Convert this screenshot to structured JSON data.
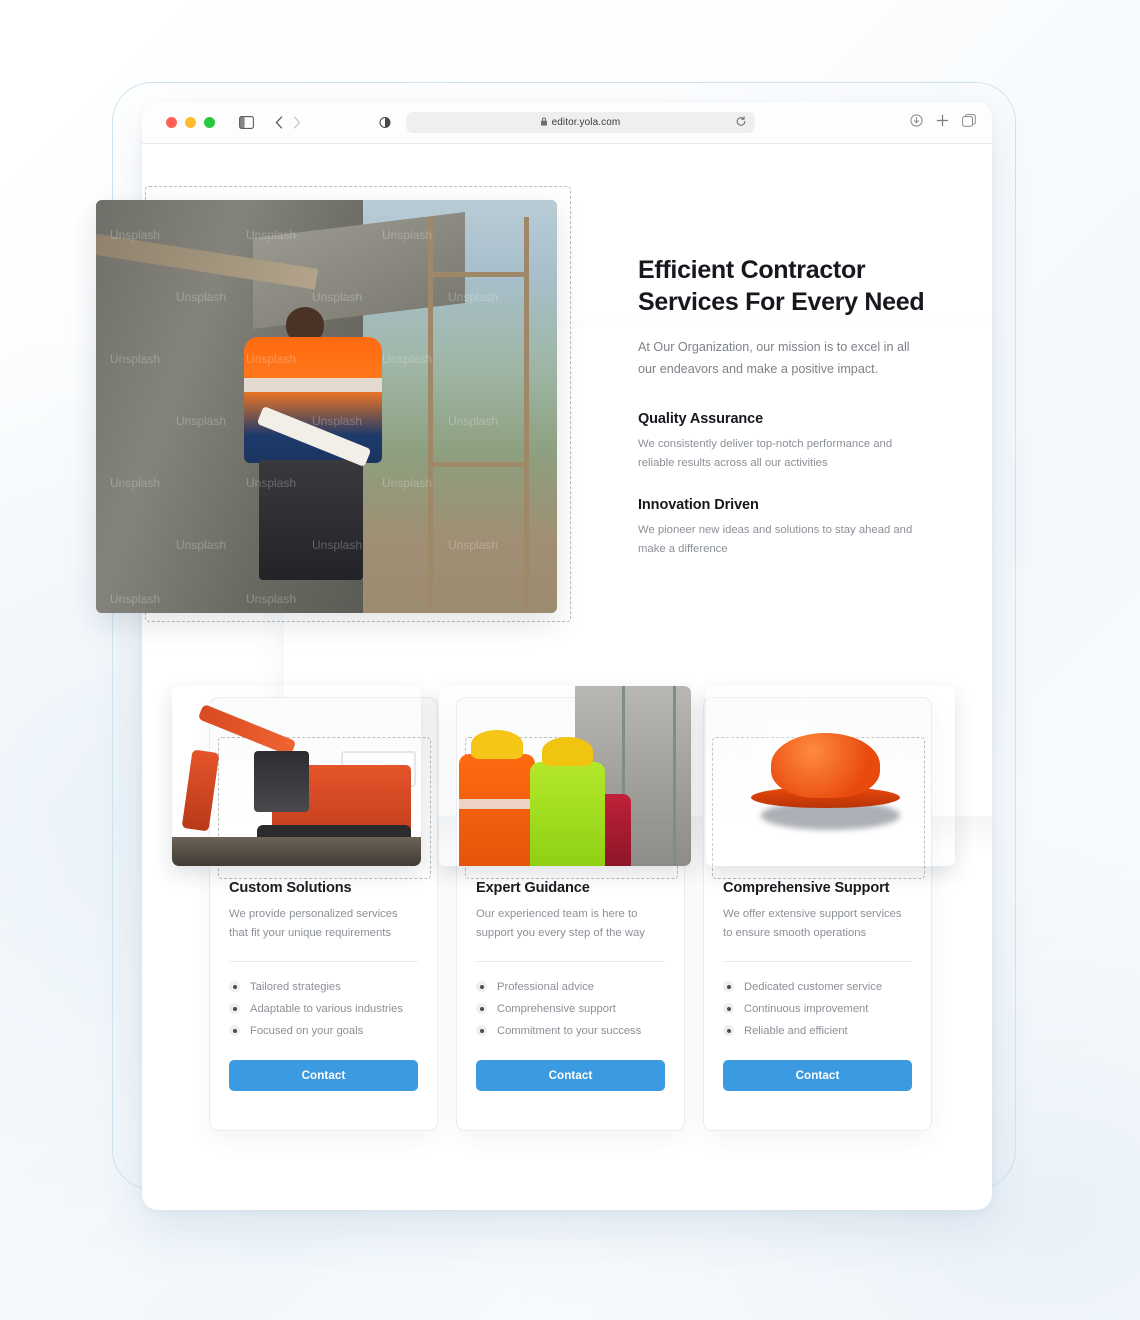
{
  "browser": {
    "url": "editor.yola.com",
    "lock_glyph": "\u0000",
    "icons": {
      "sidebar": "sidebar-toggle-icon",
      "back": "back-arrow-icon",
      "forward": "forward-arrow-icon",
      "reader": "reader-view-icon",
      "lock": "lock-icon",
      "reload": "reload-icon",
      "download": "download-icon",
      "new_tab": "plus-icon",
      "tabs": "tab-overview-icon"
    },
    "traffic_lights": {
      "close": "#ff5f57",
      "minimize": "#febc2e",
      "maximize": "#28c840"
    }
  },
  "hero": {
    "title": "Efficient Contractor Services For Every Need",
    "subtitle": "At Our Organization, our mission is to excel in all our endeavors and make a positive impact.",
    "image_alt": "construction-worker-with-blueprints",
    "image_watermark": "Unsplash",
    "features": [
      {
        "title": "Quality Assurance",
        "description": "We consistently deliver top-notch performance and reliable results across all our activities"
      },
      {
        "title": "Innovation Driven",
        "description": "We pioneer new ideas and solutions to stay ahead and make a difference"
      }
    ]
  },
  "cards": [
    {
      "title": "Custom Solutions",
      "description": "We provide personalized services that fit your unique requirements",
      "image_alt": "orange-excavator",
      "bullets": [
        "Tailored strategies",
        "Adaptable to various industries",
        "Focused on your goals"
      ],
      "button_label": "Contact"
    },
    {
      "title": "Expert Guidance",
      "description": "Our experienced team is here to support you every step of the way",
      "image_alt": "two-workers-in-hard-hats",
      "bullets": [
        "Professional advice",
        "Comprehensive support",
        "Commitment to your success"
      ],
      "button_label": "Contact"
    },
    {
      "title": "Comprehensive Support",
      "description": "We offer extensive support services to ensure smooth operations",
      "image_alt": "orange-hard-hat-on-solar-panels",
      "bullets": [
        "Dedicated customer service",
        "Continuous improvement",
        "Reliable and efficient"
      ],
      "button_label": "Contact"
    }
  ],
  "theme": {
    "accent": "#3c9ae0",
    "heading": "#16181d",
    "body_text": "#8b9097",
    "selection_dash": "#bdbdbd",
    "frame_border": "#cfe4f2"
  }
}
